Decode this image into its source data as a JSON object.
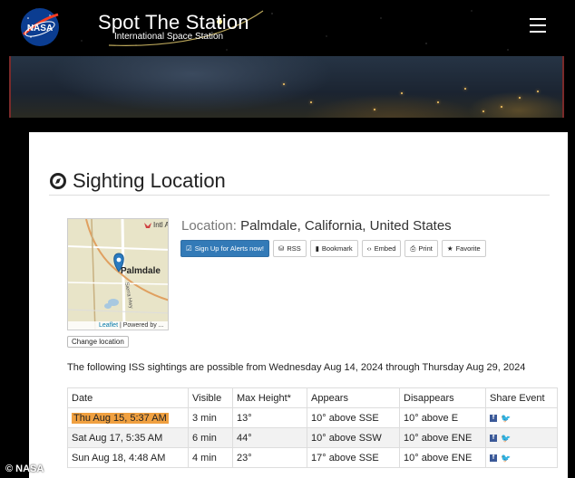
{
  "header": {
    "title": "Spot The Station",
    "subtitle": "International Space Station",
    "logo_text": "NASA"
  },
  "main": {
    "section_title": "Sighting Location",
    "location_label": "Location:",
    "location_value": "Palmdale, California, United States",
    "buttons": {
      "signup": "Sign Up for Alerts now!",
      "rss": "RSS",
      "bookmark": "Bookmark",
      "embed": "Embed",
      "print": "Print",
      "favorite": "Favorite"
    },
    "change_location": "Change location",
    "map": {
      "city_label": "Palmdale",
      "airport_label": "Intl Af",
      "road_label": "Sierra Hwy",
      "attribution_link": "Leaflet",
      "attribution_text": "| Powered by ..."
    },
    "intro": "The following ISS sightings are possible from Wednesday Aug 14, 2024 through Thursday Aug 29, 2024"
  },
  "table": {
    "headers": [
      "Date",
      "Visible",
      "Max Height*",
      "Appears",
      "Disappears",
      "Share Event"
    ],
    "rows": [
      {
        "date": "Thu Aug 15, 5:37 AM",
        "visible": "3 min",
        "max_height": "13°",
        "appears": "10° above SSE",
        "disappears": "10° above E"
      },
      {
        "date": "Sat Aug 17, 5:35 AM",
        "visible": "6 min",
        "max_height": "44°",
        "appears": "10° above SSW",
        "disappears": "10° above ENE"
      },
      {
        "date": "Sun Aug 18, 4:48 AM",
        "visible": "4 min",
        "max_height": "23°",
        "appears": "17° above SSE",
        "disappears": "10° above ENE"
      }
    ]
  },
  "watermark": "© NASA",
  "colors": {
    "primary_button": "#337ab7",
    "highlight": "#f0a040",
    "facebook": "#3b5998",
    "twitter": "#1da1f2"
  }
}
